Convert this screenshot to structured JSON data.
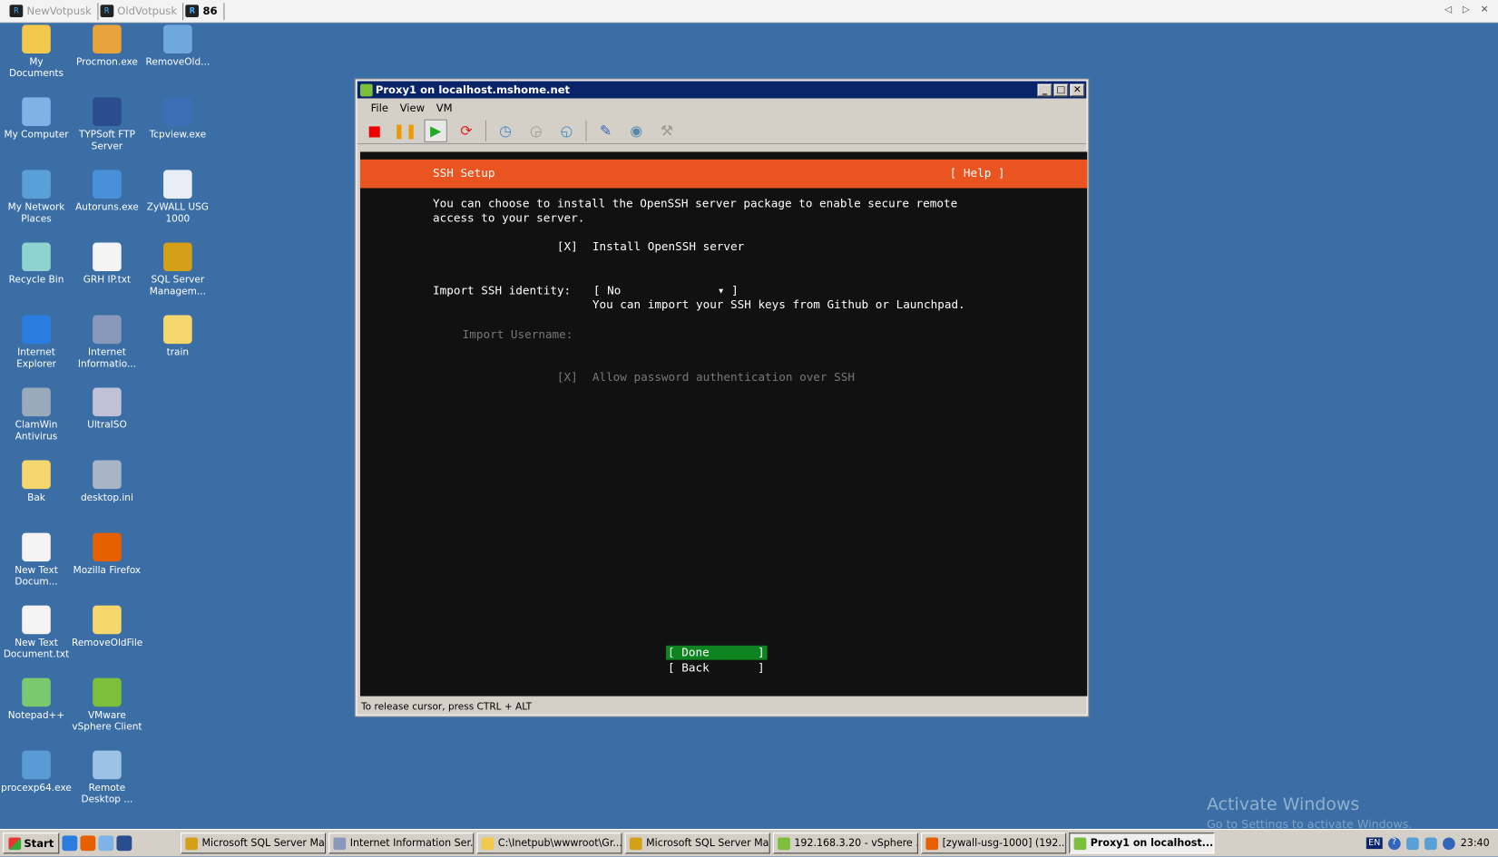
{
  "topbar": {
    "tabs": [
      {
        "label": "NewVotpusk",
        "active": false
      },
      {
        "label": "OldVotpusk",
        "active": false
      },
      {
        "label": "86",
        "active": true
      }
    ],
    "nav": "◁ ▷ ✕"
  },
  "desktop": {
    "icons": [
      {
        "label": "My Documents",
        "color": "#f2c94c"
      },
      {
        "label": "My Computer",
        "color": "#7fb2e5"
      },
      {
        "label": "My Network Places",
        "color": "#5aa0d8"
      },
      {
        "label": "Recycle Bin",
        "color": "#8fd3d0"
      },
      {
        "label": "Internet Explorer",
        "color": "#2b7de0"
      },
      {
        "label": "ClamWin Antivirus",
        "color": "#9ab"
      },
      {
        "label": "Bak",
        "color": "#f5d76e"
      },
      {
        "label": "New Text Docum...",
        "color": "#f4f4f4"
      },
      {
        "label": "New Text Document.txt",
        "color": "#f4f4f4"
      },
      {
        "label": "Notepad++",
        "color": "#7bc96f"
      },
      {
        "label": "procexp64.exe",
        "color": "#5b9bd5"
      },
      {
        "label": "Procmon.exe",
        "color": "#e8a33c"
      },
      {
        "label": "TYPSoft FTP Server",
        "color": "#2a4d8f"
      },
      {
        "label": "Autoruns.exe",
        "color": "#4a90d9"
      },
      {
        "label": "GRH IP.txt",
        "color": "#f4f4f4"
      },
      {
        "label": "Internet Informatio...",
        "color": "#8899bb"
      },
      {
        "label": "UltraISO",
        "color": "#c0c0d8"
      },
      {
        "label": "desktop.ini",
        "color": "#a8b4c8"
      },
      {
        "label": "Mozilla Firefox",
        "color": "#e66000"
      },
      {
        "label": "RemoveOldFile",
        "color": "#f5d76e"
      },
      {
        "label": "VMware vSphere Client",
        "color": "#7bbf3a"
      },
      {
        "label": "Remote Desktop ...",
        "color": "#9cc3e6"
      },
      {
        "label": "RemoveOld...",
        "color": "#6fa8dc"
      },
      {
        "label": "Tcpview.exe",
        "color": "#3d6fb6"
      },
      {
        "label": "ZyWALL USG 1000",
        "color": "#e8eef5"
      },
      {
        "label": "SQL Server Managem...",
        "color": "#d4a017"
      },
      {
        "label": "train",
        "color": "#f5d76e"
      }
    ],
    "watermark_title": "Activate Windows",
    "watermark_sub": "Go to Settings to activate Windows."
  },
  "window": {
    "title": "Proxy1 on localhost.mshome.net",
    "controls": [
      "_",
      "□",
      "✕"
    ],
    "menu": [
      "File",
      "View",
      "VM"
    ],
    "toolbar": [
      {
        "name": "stop",
        "glyph": "■",
        "color": "#e00"
      },
      {
        "name": "pause",
        "glyph": "❚❚",
        "color": "#e90"
      },
      {
        "name": "play",
        "glyph": "▶",
        "color": "#2a2"
      },
      {
        "name": "reset",
        "glyph": "⟳",
        "color": "#d22"
      },
      {
        "name": "snapshot",
        "glyph": "◷",
        "color": "#48c"
      },
      {
        "name": "revert",
        "glyph": "◶",
        "color": "#999"
      },
      {
        "name": "manage-snapshots",
        "glyph": "◵",
        "color": "#48c"
      },
      {
        "name": "edit-settings",
        "glyph": "✎",
        "color": "#36b"
      },
      {
        "name": "cd-dvd",
        "glyph": "◉",
        "color": "#58a"
      },
      {
        "name": "usb",
        "glyph": "⚒",
        "color": "#999"
      }
    ],
    "status": "To release cursor, press CTRL + ALT"
  },
  "installer": {
    "header": "SSH Setup",
    "help": "[ Help ]",
    "desc1": "You can choose to install the OpenSSH server package to enable secure remote",
    "desc2": "access to your server.",
    "install_check": "[X]",
    "install_label": "Install OpenSSH server",
    "identity_label": "Import SSH identity:",
    "identity_value": "[ No              ▾ ]",
    "identity_hint": "You can import your SSH keys from Github or Launchpad.",
    "username_label": "Import Username:",
    "password_check": "[X]",
    "password_label": "Allow password authentication over SSH",
    "done": "[ Done       ]",
    "back": "[ Back       ]",
    "accent": "#e95420",
    "focus": "#0e8420"
  },
  "taskbar": {
    "start": "Start",
    "tasks": [
      {
        "label": "Microsoft SQL Server Ma...",
        "color": "#d4a017"
      },
      {
        "label": "Internet Information Ser...",
        "color": "#8899bb"
      },
      {
        "label": "C:\\Inetpub\\wwwroot\\Gr...",
        "color": "#f2c94c"
      },
      {
        "label": "Microsoft SQL Server Ma...",
        "color": "#d4a017"
      },
      {
        "label": "192.168.3.20 - vSphere ...",
        "color": "#7bbf3a"
      },
      {
        "label": "[zywall-usg-1000] (192....",
        "color": "#e66000"
      },
      {
        "label": "Proxy1 on localhost....",
        "color": "#7bbf3a",
        "active": true
      }
    ],
    "lang": "EN",
    "help": "?",
    "clock": "23:40"
  }
}
